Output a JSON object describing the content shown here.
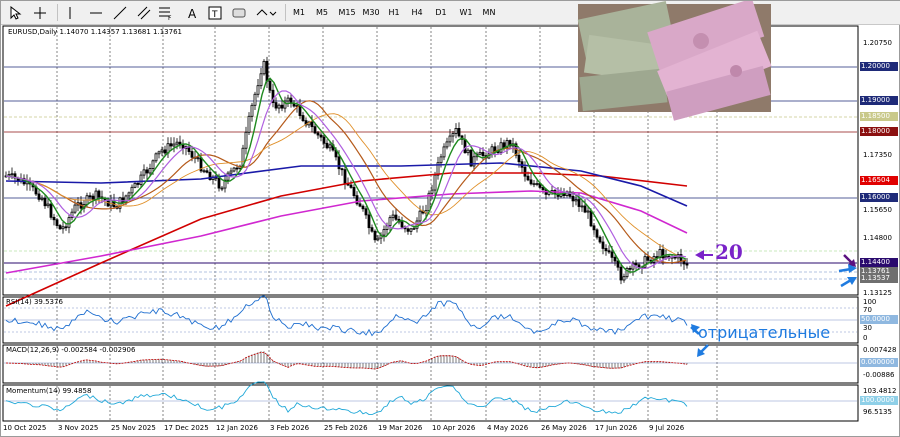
{
  "toolbar": {
    "timeframes": [
      "M1",
      "M5",
      "M15",
      "M30",
      "H1",
      "H4",
      "D1",
      "W1",
      "MN"
    ]
  },
  "chart": {
    "symbol_line": "EURUSD,Daily  1.14070 1.14357 1.13681 1.13761",
    "price_axis": [
      "1.20750",
      "1.17350",
      "1.15650",
      "1.14800",
      "1.13125"
    ],
    "price_tags": [
      {
        "text": "1.20000",
        "bg": "#1e2a78"
      },
      {
        "text": "1.19000",
        "bg": "#1e2a78"
      },
      {
        "text": "1.18500",
        "bg": "#c9c98a"
      },
      {
        "text": "1.18000",
        "bg": "#8b1010"
      },
      {
        "text": "1.16504",
        "bg": "#e00000"
      },
      {
        "text": "1.16000",
        "bg": "#1e2a78"
      },
      {
        "text": "1.14400",
        "bg": "#2a0a6e"
      },
      {
        "text": "1.13761",
        "bg": "#6f6f6f"
      },
      {
        "text": "1.13537",
        "bg": "#6f6f6f"
      }
    ],
    "annotation_number": "20",
    "annotation_text": "отрицательные",
    "dates": [
      "10 Oct 2025",
      "3 Nov 2025",
      "25 Nov 2025",
      "17 Dec 2025",
      "12 Jan 2026",
      "3 Feb 2026",
      "25 Feb 2026",
      "19 Mar 2026",
      "10 Apr 2026",
      "4 May 2026",
      "26 May 2026",
      "17 Jun 2026",
      "9 Jul 2026"
    ]
  },
  "rsi": {
    "title": "RSI(14) 39.5376",
    "axis": [
      "100",
      "70",
      "30",
      "0"
    ],
    "tag": "50.0000"
  },
  "macd": {
    "title": "MACD(12,26,9) -0.002584 -0.002906",
    "axis": [
      "0.007428",
      "-0.00886"
    ],
    "tag": "0.000000"
  },
  "momentum": {
    "title": "Momentum(14) 99.4858",
    "axis": [
      "103.4812",
      "96.5135"
    ],
    "tag": "100.0000"
  },
  "colors": {
    "ma_red": "#d10000",
    "ma_blue": "#1a1aa8",
    "ma_magenta": "#d028d0",
    "ma_green": "#1f8a1f",
    "ma_brown": "#b55a1a",
    "annotation": "#7a23c8",
    "arrow": "#1f7be0"
  }
}
